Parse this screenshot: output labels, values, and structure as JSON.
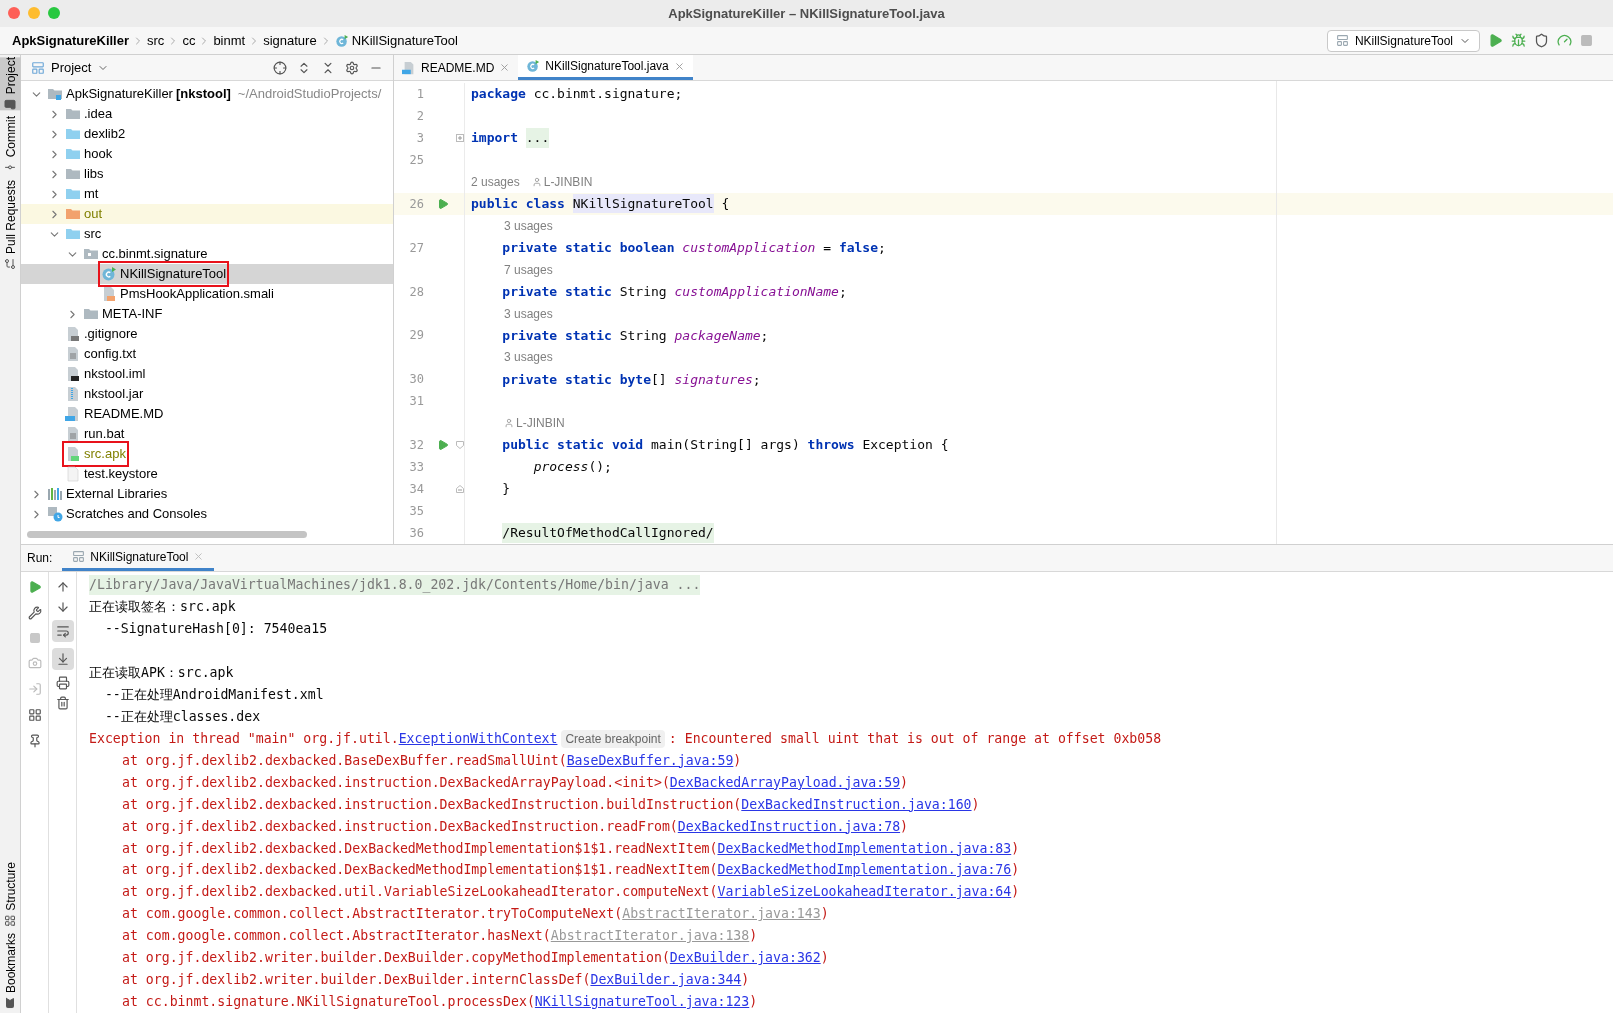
{
  "window": {
    "title": "ApkSignatureKiller – NKillSignatureTool.java"
  },
  "breadcrumbs": [
    {
      "label": "ApkSignatureKiller",
      "kind": "project"
    },
    {
      "label": "src",
      "kind": "folder"
    },
    {
      "label": "cc",
      "kind": "folder"
    },
    {
      "label": "binmt",
      "kind": "folder"
    },
    {
      "label": "signature",
      "kind": "folder"
    },
    {
      "label": "NKillSignatureTool",
      "kind": "class"
    }
  ],
  "run_config": {
    "label": "NKillSignatureTool"
  },
  "tool_strip": {
    "top": [
      {
        "label": "Project",
        "kind": "folder",
        "selected": true
      },
      {
        "label": "Commit",
        "kind": "commit",
        "selected": false
      },
      {
        "label": "Pull Requests",
        "kind": "pull",
        "selected": false
      }
    ],
    "bottom": [
      {
        "label": "Structure",
        "kind": "structure",
        "selected": false
      },
      {
        "label": "Bookmarks",
        "kind": "bookmark",
        "selected": false
      }
    ]
  },
  "project_panel": {
    "title": "Project",
    "tree": [
      {
        "label": "ApkSignatureKiller",
        "tag": "[nkstool]",
        "path": "~/AndroidStudioProjects/",
        "kind": "project",
        "expanded": true,
        "selected": false,
        "boxed": false,
        "children": [
          {
            "label": ".idea",
            "kind": "folder",
            "expanded": false,
            "selected": false,
            "boxed": false
          },
          {
            "label": "dexlib2",
            "kind": "module",
            "expanded": false,
            "selected": false,
            "boxed": false
          },
          {
            "label": "hook",
            "kind": "module",
            "expanded": false,
            "selected": false,
            "boxed": false
          },
          {
            "label": "libs",
            "kind": "folder",
            "expanded": false,
            "selected": false,
            "boxed": false
          },
          {
            "label": "mt",
            "kind": "module",
            "expanded": false,
            "selected": false,
            "boxed": false
          },
          {
            "label": "out",
            "kind": "excluded",
            "expanded": false,
            "selected": false,
            "boxed": false,
            "color": "#808000"
          },
          {
            "label": "src",
            "kind": "module",
            "expanded": true,
            "selected": false,
            "boxed": false,
            "children": [
              {
                "label": "cc.binmt.signature",
                "kind": "package",
                "expanded": true,
                "selected": false,
                "boxed": false,
                "children": [
                  {
                    "label": "NKillSignatureTool",
                    "kind": "class",
                    "selected": true,
                    "boxed": true
                  },
                  {
                    "label": "PmsHookApplication.smali",
                    "kind": "smali",
                    "selected": false,
                    "boxed": false
                  }
                ]
              },
              {
                "label": "META-INF",
                "kind": "folder",
                "expanded": false,
                "selected": false,
                "boxed": false
              }
            ]
          },
          {
            "label": ".gitignore",
            "kind": "ignore",
            "selected": false,
            "boxed": false
          },
          {
            "label": "config.txt",
            "kind": "text",
            "selected": false,
            "boxed": false
          },
          {
            "label": "nkstool.iml",
            "kind": "iml",
            "selected": false,
            "boxed": false
          },
          {
            "label": "nkstool.jar",
            "kind": "jar",
            "selected": false,
            "boxed": false
          },
          {
            "label": "README.MD",
            "kind": "markdown",
            "selected": false,
            "boxed": false
          },
          {
            "label": "run.bat",
            "kind": "text",
            "selected": false,
            "boxed": false
          },
          {
            "label": "src.apk",
            "kind": "apk",
            "selected": false,
            "boxed": true,
            "color": "#808000"
          },
          {
            "label": "test.keystore",
            "kind": "blank",
            "selected": false,
            "boxed": false
          }
        ]
      },
      {
        "label": "External Libraries",
        "kind": "libraries",
        "expanded": false,
        "selected": false,
        "boxed": false
      },
      {
        "label": "Scratches and Consoles",
        "kind": "scratches",
        "expanded": false,
        "selected": false,
        "boxed": false
      }
    ]
  },
  "editor": {
    "tabs": [
      {
        "label": "README.MD",
        "kind": "markdown",
        "selected": false
      },
      {
        "label": "NKillSignatureTool.java",
        "kind": "class",
        "selected": true
      }
    ],
    "lines": [
      {
        "kind": "code",
        "number": "1",
        "current": false,
        "tokens": [
          {
            "text": "package",
            "kind": "kw"
          },
          {
            "text": " cc.binmt.signature;",
            "kind": "plain"
          }
        ]
      },
      {
        "kind": "code",
        "number": "2",
        "current": false
      },
      {
        "kind": "code",
        "number": "3",
        "current": false,
        "collapsed": true,
        "tokens": [
          {
            "text": "import ",
            "kind": "kw"
          },
          {
            "text": "...",
            "kind": "folded"
          }
        ]
      },
      {
        "kind": "code",
        "number": "25",
        "current": false
      },
      {
        "kind": "hint",
        "inside_class": false,
        "text": "2 usages",
        "author": "L-JINBIN"
      },
      {
        "kind": "code",
        "number": "26",
        "current": true,
        "runnable": true,
        "tokens": [
          {
            "text": "public class ",
            "kind": "kw"
          },
          {
            "text": "NKillSignatureTool",
            "kind": "declared"
          },
          {
            "text": " {",
            "kind": "plain"
          }
        ]
      },
      {
        "kind": "hint",
        "inside_class": true,
        "text": "3 usages"
      },
      {
        "kind": "code",
        "number": "27",
        "current": false,
        "tokens": [
          {
            "text": "    private static boolean ",
            "kind": "kw"
          },
          {
            "text": "customApplication",
            "kind": "field"
          },
          {
            "text": " = ",
            "kind": "plain"
          },
          {
            "text": "false",
            "kind": "kw"
          },
          {
            "text": ";",
            "kind": "plain"
          }
        ]
      },
      {
        "kind": "hint",
        "inside_class": true,
        "text": "7 usages"
      },
      {
        "kind": "code",
        "number": "28",
        "current": false,
        "tokens": [
          {
            "text": "    private static",
            "kind": "kw"
          },
          {
            "text": " String ",
            "kind": "plain"
          },
          {
            "text": "customApplicationName",
            "kind": "field"
          },
          {
            "text": ";",
            "kind": "plain"
          }
        ]
      },
      {
        "kind": "hint",
        "inside_class": true,
        "text": "3 usages"
      },
      {
        "kind": "code",
        "number": "29",
        "current": false,
        "tokens": [
          {
            "text": "    private static",
            "kind": "kw"
          },
          {
            "text": " String ",
            "kind": "plain"
          },
          {
            "text": "packageName",
            "kind": "field"
          },
          {
            "text": ";",
            "kind": "plain"
          }
        ]
      },
      {
        "kind": "hint",
        "inside_class": true,
        "text": "3 usages"
      },
      {
        "kind": "code",
        "number": "30",
        "current": false,
        "tokens": [
          {
            "text": "    private static byte",
            "kind": "kw"
          },
          {
            "text": "[] ",
            "kind": "plain"
          },
          {
            "text": "signatures",
            "kind": "field"
          },
          {
            "text": ";",
            "kind": "plain"
          }
        ]
      },
      {
        "kind": "code",
        "number": "31",
        "current": false
      },
      {
        "kind": "hint",
        "inside_class": true,
        "author": "L-JINBIN"
      },
      {
        "kind": "code",
        "number": "32",
        "current": false,
        "runnable": true,
        "fold_start": true,
        "tokens": [
          {
            "text": "    public static void",
            "kind": "kw"
          },
          {
            "text": " main(String[] args) ",
            "kind": "plain"
          },
          {
            "text": "throws",
            "kind": "kw"
          },
          {
            "text": " Exception {",
            "kind": "plain"
          }
        ]
      },
      {
        "kind": "code",
        "number": "33",
        "current": false,
        "tokens": [
          {
            "text": "        process",
            "kind": "call"
          },
          {
            "text": "();",
            "kind": "plain"
          }
        ]
      },
      {
        "kind": "code",
        "number": "34",
        "current": false,
        "fold_end": true,
        "tokens": [
          {
            "text": "    }",
            "kind": "plain"
          }
        ]
      },
      {
        "kind": "code",
        "number": "35",
        "current": false
      },
      {
        "kind": "code",
        "number": "36",
        "current": false,
        "tokens": [
          {
            "text": "    /ResultOfMethodCallIgnored/",
            "kind": "folded"
          }
        ]
      }
    ]
  },
  "run_panel": {
    "title": "Run:",
    "tab": {
      "label": "NKillSignatureTool",
      "selected": true
    },
    "soft_wrap": true,
    "scroll_to_end": true,
    "lines": [
      {
        "kind": "command",
        "parts": [
          {
            "kind": "text",
            "text": "/Library/Java/JavaVirtualMachines/jdk1.8.0_202.jdk/Contents/Home/bin/java ..."
          }
        ]
      },
      {
        "kind": "output",
        "parts": [
          {
            "kind": "text",
            "text": "正在读取签名：src.apk"
          }
        ]
      },
      {
        "kind": "output",
        "parts": [
          {
            "kind": "text",
            "text": "  --SignatureHash[0]: 7540ea15"
          }
        ]
      },
      {
        "kind": "blank"
      },
      {
        "kind": "output",
        "parts": [
          {
            "kind": "text",
            "text": "正在读取APK：src.apk"
          }
        ]
      },
      {
        "kind": "output",
        "parts": [
          {
            "kind": "text",
            "text": "  --正在处理AndroidManifest.xml"
          }
        ]
      },
      {
        "kind": "output",
        "parts": [
          {
            "kind": "text",
            "text": "  --正在处理classes.dex"
          }
        ]
      },
      {
        "kind": "error",
        "parts": [
          {
            "kind": "text",
            "text": "Exception in thread \"main\" org.jf.util."
          },
          {
            "kind": "link",
            "text": "ExceptionWithContext"
          },
          {
            "kind": "chip",
            "text": "Create breakpoint"
          },
          {
            "kind": "text",
            "text": ": Encountered small uint that is out of range at offset 0xb058"
          }
        ]
      },
      {
        "kind": "trace",
        "parts": [
          {
            "kind": "text",
            "text": "at org.jf.dexlib2.dexbacked.BaseDexBuffer.readSmallUint("
          },
          {
            "kind": "link",
            "text": "BaseDexBuffer.java:59"
          },
          {
            "kind": "text",
            "text": ")"
          }
        ]
      },
      {
        "kind": "trace",
        "parts": [
          {
            "kind": "text",
            "text": "at org.jf.dexlib2.dexbacked.instruction.DexBackedArrayPayload.<init>("
          },
          {
            "kind": "link",
            "text": "DexBackedArrayPayload.java:59"
          },
          {
            "kind": "text",
            "text": ")"
          }
        ]
      },
      {
        "kind": "trace",
        "parts": [
          {
            "kind": "text",
            "text": "at org.jf.dexlib2.dexbacked.instruction.DexBackedInstruction.buildInstruction("
          },
          {
            "kind": "link",
            "text": "DexBackedInstruction.java:160"
          },
          {
            "kind": "text",
            "text": ")"
          }
        ]
      },
      {
        "kind": "trace",
        "parts": [
          {
            "kind": "text",
            "text": "at org.jf.dexlib2.dexbacked.instruction.DexBackedInstruction.readFrom("
          },
          {
            "kind": "link",
            "text": "DexBackedInstruction.java:78"
          },
          {
            "kind": "text",
            "text": ")"
          }
        ]
      },
      {
        "kind": "trace",
        "parts": [
          {
            "kind": "text",
            "text": "at org.jf.dexlib2.dexbacked.DexBackedMethodImplementation$1$1.readNextItem("
          },
          {
            "kind": "link",
            "text": "DexBackedMethodImplementation.java:83"
          },
          {
            "kind": "text",
            "text": ")"
          }
        ]
      },
      {
        "kind": "trace",
        "parts": [
          {
            "kind": "text",
            "text": "at org.jf.dexlib2.dexbacked.DexBackedMethodImplementation$1$1.readNextItem("
          },
          {
            "kind": "link",
            "text": "DexBackedMethodImplementation.java:76"
          },
          {
            "kind": "text",
            "text": ")"
          }
        ]
      },
      {
        "kind": "trace",
        "parts": [
          {
            "kind": "text",
            "text": "at org.jf.dexlib2.dexbacked.util.VariableSizeLookaheadIterator.computeNext("
          },
          {
            "kind": "link",
            "text": "VariableSizeLookaheadIterator.java:64"
          },
          {
            "kind": "text",
            "text": ")"
          }
        ]
      },
      {
        "kind": "trace",
        "parts": [
          {
            "kind": "text",
            "text": "at com.google.common.collect.AbstractIterator.tryToComputeNext("
          },
          {
            "kind": "library_link",
            "text": "AbstractIterator.java:143"
          },
          {
            "kind": "text",
            "text": ")"
          }
        ]
      },
      {
        "kind": "trace",
        "parts": [
          {
            "kind": "text",
            "text": "at com.google.common.collect.AbstractIterator.hasNext("
          },
          {
            "kind": "library_link",
            "text": "AbstractIterator.java:138"
          },
          {
            "kind": "text",
            "text": ")"
          }
        ]
      },
      {
        "kind": "trace",
        "parts": [
          {
            "kind": "text",
            "text": "at org.jf.dexlib2.writer.builder.DexBuilder.copyMethodImplementation("
          },
          {
            "kind": "link",
            "text": "DexBuilder.java:362"
          },
          {
            "kind": "text",
            "text": ")"
          }
        ]
      },
      {
        "kind": "trace",
        "parts": [
          {
            "kind": "text",
            "text": "at org.jf.dexlib2.writer.builder.DexBuilder.internClassDef("
          },
          {
            "kind": "link",
            "text": "DexBuilder.java:344"
          },
          {
            "kind": "text",
            "text": ")"
          }
        ]
      },
      {
        "kind": "trace",
        "parts": [
          {
            "kind": "text",
            "text": "at cc.binmt.signature.NKillSignatureTool.processDex("
          },
          {
            "kind": "link",
            "text": "NKillSignatureTool.java:123"
          },
          {
            "kind": "text",
            "text": ")"
          }
        ]
      }
    ]
  }
}
